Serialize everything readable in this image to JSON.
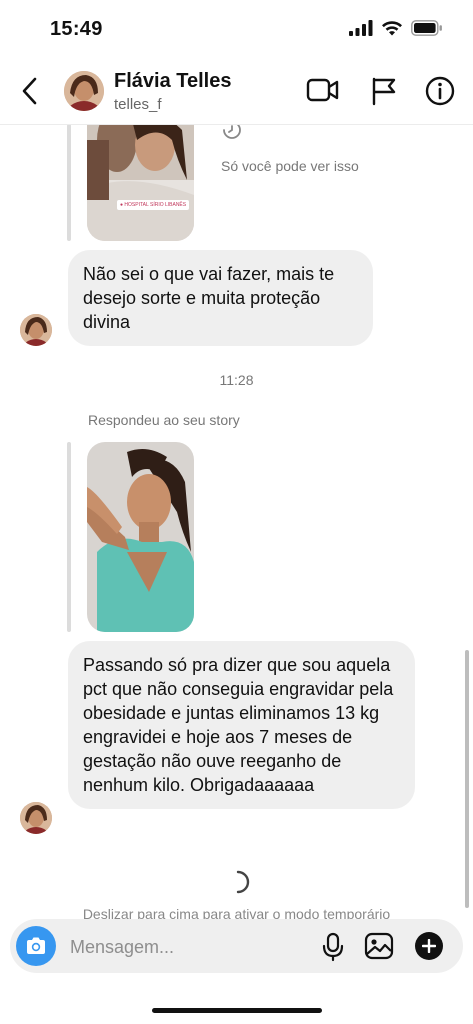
{
  "status_bar": {
    "time": "15:49"
  },
  "header": {
    "name": "Flávia Telles",
    "username": "telles_f"
  },
  "thread": {
    "story_note": "Só você pode ver isso",
    "story_badge": "HOSPITAL SÍRIO LIBANÊS",
    "message_1": "Não sei o que vai fazer, mais te desejo sorte e muita proteção divina",
    "timestamp": "11:28",
    "replied_label": "Respondeu ao seu story",
    "message_2": "Passando só  pra dizer que sou aquela pct que não conseguia engravidar pela obesidade e juntas eliminamos 13 kg engravidei e hoje aos 7 meses de gestação não  ouve reeganho de nenhum kilo. Obrigadaaaaaa",
    "temporary_mode_hint": "Deslizar para cima para ativar o modo temporário"
  },
  "composer": {
    "placeholder": "Mensagem..."
  },
  "colors": {
    "accent": "#3797f0",
    "bubble": "#efefef"
  }
}
